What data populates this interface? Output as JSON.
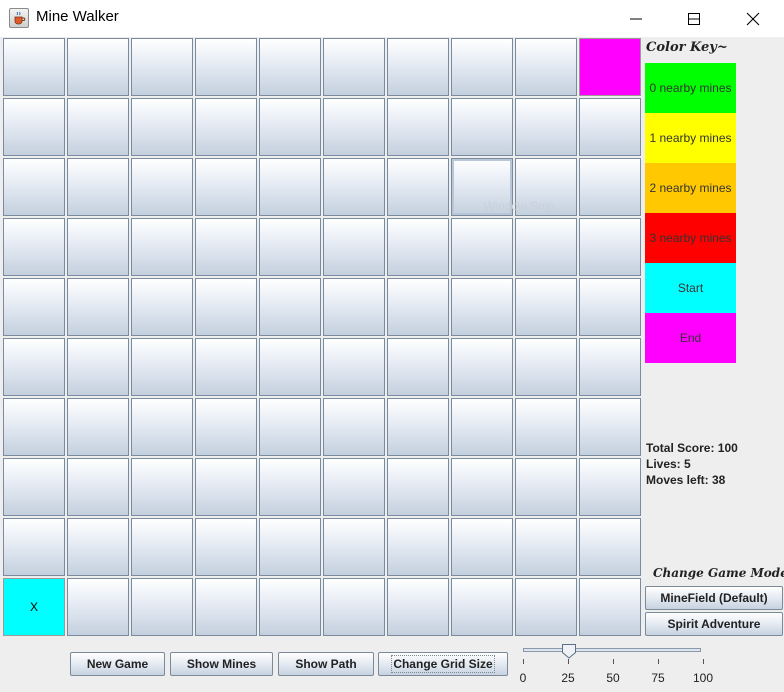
{
  "window": {
    "title": "Mine Walker",
    "app_icon": "java-cup-icon"
  },
  "title_controls": {
    "minimize": "minimize-icon",
    "maximize": "maximize-icon",
    "close": "close-icon"
  },
  "grid": {
    "rows": 10,
    "cols": 10,
    "end_cell": {
      "row": 0,
      "col": 9
    },
    "start_cell": {
      "row": 9,
      "col": 0,
      "label": "X"
    },
    "focused_cell": {
      "row": 2,
      "col": 7
    },
    "watermark": "Window Snip"
  },
  "color_key": {
    "title": "Color Key~",
    "items": [
      {
        "label": "0 nearby mines",
        "color": "#00ff00"
      },
      {
        "label": "1 nearby mines",
        "color": "#ffff00"
      },
      {
        "label": "2 nearby mines",
        "color": "#ffc800"
      },
      {
        "label": "3 nearby mines",
        "color": "#ff0000"
      },
      {
        "label": "Start",
        "color": "#00ffff"
      },
      {
        "label": "End",
        "color": "#ff00ff"
      }
    ]
  },
  "stats": {
    "score": "Total Score: 100",
    "lives": "Lives: 5",
    "moves": "Moves left: 38"
  },
  "mode": {
    "title": "Change Game Mode",
    "minefield": "MineField (Default)",
    "spirit": "Spirit Adventure"
  },
  "toolbar": {
    "new_game": "New Game",
    "show_mines": "Show Mines",
    "show_path": "Show Path",
    "change_grid": "Change Grid Size"
  },
  "slider": {
    "value": 25,
    "min": 0,
    "max": 100,
    "labels": [
      "0",
      "25",
      "50",
      "75",
      "100"
    ]
  }
}
